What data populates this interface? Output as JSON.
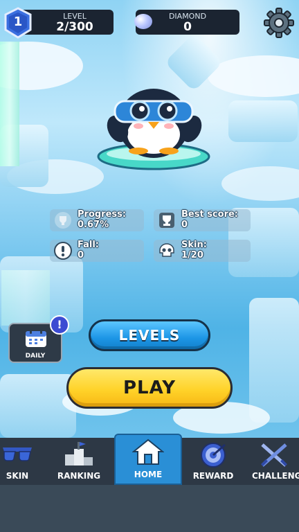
{
  "hud": {
    "level_caption": "LEVEL",
    "level_value": "2/300",
    "level_badge": "1",
    "diamond_caption": "DIAMOND",
    "diamond_value": "0"
  },
  "stats": {
    "progress_label": "Progress:",
    "progress_value": "0.67%",
    "best_label": "Best score:",
    "best_value": "0",
    "fall_label": "Fall:",
    "fall_value": "0",
    "skin_label": "Skin:",
    "skin_value": "1/20"
  },
  "daily": {
    "label": "DAILY",
    "alert": "!"
  },
  "buttons": {
    "levels": "LEVELS",
    "play": "PLAY"
  },
  "nav": {
    "skin": "SKIN",
    "ranking": "RANKING",
    "home": "HOME",
    "reward": "REWARD",
    "challenge": "CHALLENGE"
  },
  "icons": {
    "level_badge": "shield-icon",
    "diamond": "diamond-icon",
    "settings": "gear-icon",
    "progress": "trophy-icon",
    "best": "cup-icon",
    "fall": "alert-icon",
    "skin": "skull-icon",
    "daily": "calendar-icon"
  },
  "colors": {
    "hud_bg": "#1b2431",
    "levels_button": "#1d96e6",
    "play_button": "#ffd32a",
    "nav_bg": "#2d3845",
    "nav_active": "#2a8fd6"
  }
}
